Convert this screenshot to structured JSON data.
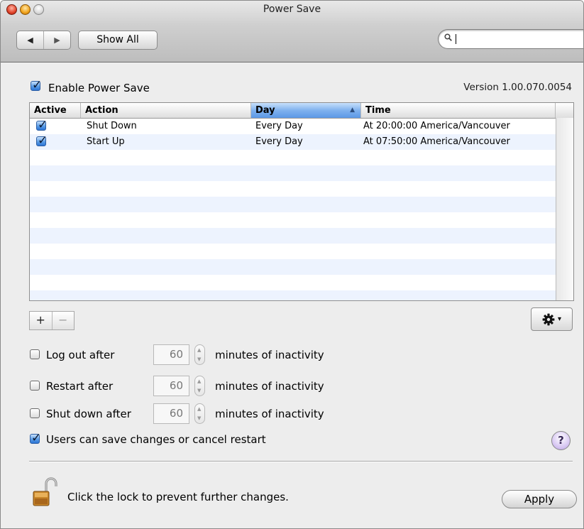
{
  "window": {
    "title": "Power Save"
  },
  "toolbar": {
    "back_glyph": "◀",
    "forward_glyph": "▶",
    "show_all_label": "Show All",
    "search_value": ""
  },
  "enable": {
    "label": "Enable Power Save",
    "checked": true
  },
  "version": "Version 1.00.070.0054",
  "table": {
    "columns": [
      "Active",
      "Action",
      "Day",
      "Time"
    ],
    "sort_column": "Day",
    "sort_arrow": "▲",
    "rows": [
      {
        "active": true,
        "action": "Shut Down",
        "day": "Every Day",
        "time": "At 20:00:00 America/Vancouver"
      },
      {
        "active": true,
        "action": "Start Up",
        "day": "Every Day",
        "time": "At 07:50:00 America/Vancouver"
      }
    ]
  },
  "list_controls": {
    "add": "+",
    "remove": "−",
    "gear_dropdown": "▾"
  },
  "options": [
    {
      "label": "Log out after",
      "value": "60",
      "suffix": "minutes of inactivity",
      "checked": false
    },
    {
      "label": "Restart after",
      "value": "60",
      "suffix": "minutes of inactivity",
      "checked": false
    },
    {
      "label": "Shut down after",
      "value": "60",
      "suffix": "minutes of inactivity",
      "checked": false
    }
  ],
  "users_option": {
    "label": "Users can save changes or cancel restart",
    "checked": true
  },
  "help_label": "?",
  "lock": {
    "text": "Click the lock to prevent further changes."
  },
  "apply_label": "Apply"
}
